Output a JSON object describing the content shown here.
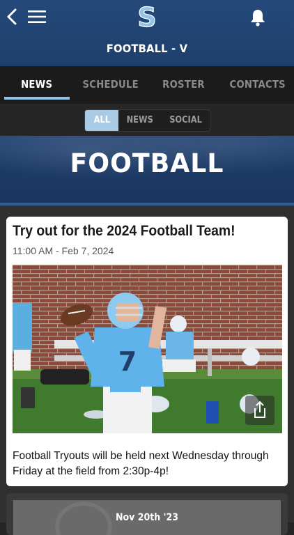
{
  "header": {
    "title": "FOOTBALL - V",
    "logo_letter": "S"
  },
  "tabs": [
    {
      "label": "NEWS",
      "active": true
    },
    {
      "label": "SCHEDULE",
      "active": false
    },
    {
      "label": "ROSTER",
      "active": false
    },
    {
      "label": "CONTACTS",
      "active": false
    }
  ],
  "filters": {
    "options": [
      "ALL",
      "NEWS",
      "SOCIAL"
    ],
    "selected": "ALL"
  },
  "banner": {
    "text": "FOOTBALL"
  },
  "posts": [
    {
      "title": "Try out for the 2024 Football Team!",
      "date": "11:00 AM - Feb 7, 2024",
      "body": "Football Tryouts will be held next Wednesday through Friday at the field from 2:30p-4p!",
      "jersey_number": "7"
    },
    {
      "date_label": "Nov 20th '23"
    }
  ],
  "colors": {
    "header_blue": "#24497a",
    "accent_light_blue": "#8fc3e8",
    "segment_active": "#a9cbe6"
  },
  "icons": [
    "back-icon",
    "menu-icon",
    "bell-icon",
    "share-icon"
  ]
}
